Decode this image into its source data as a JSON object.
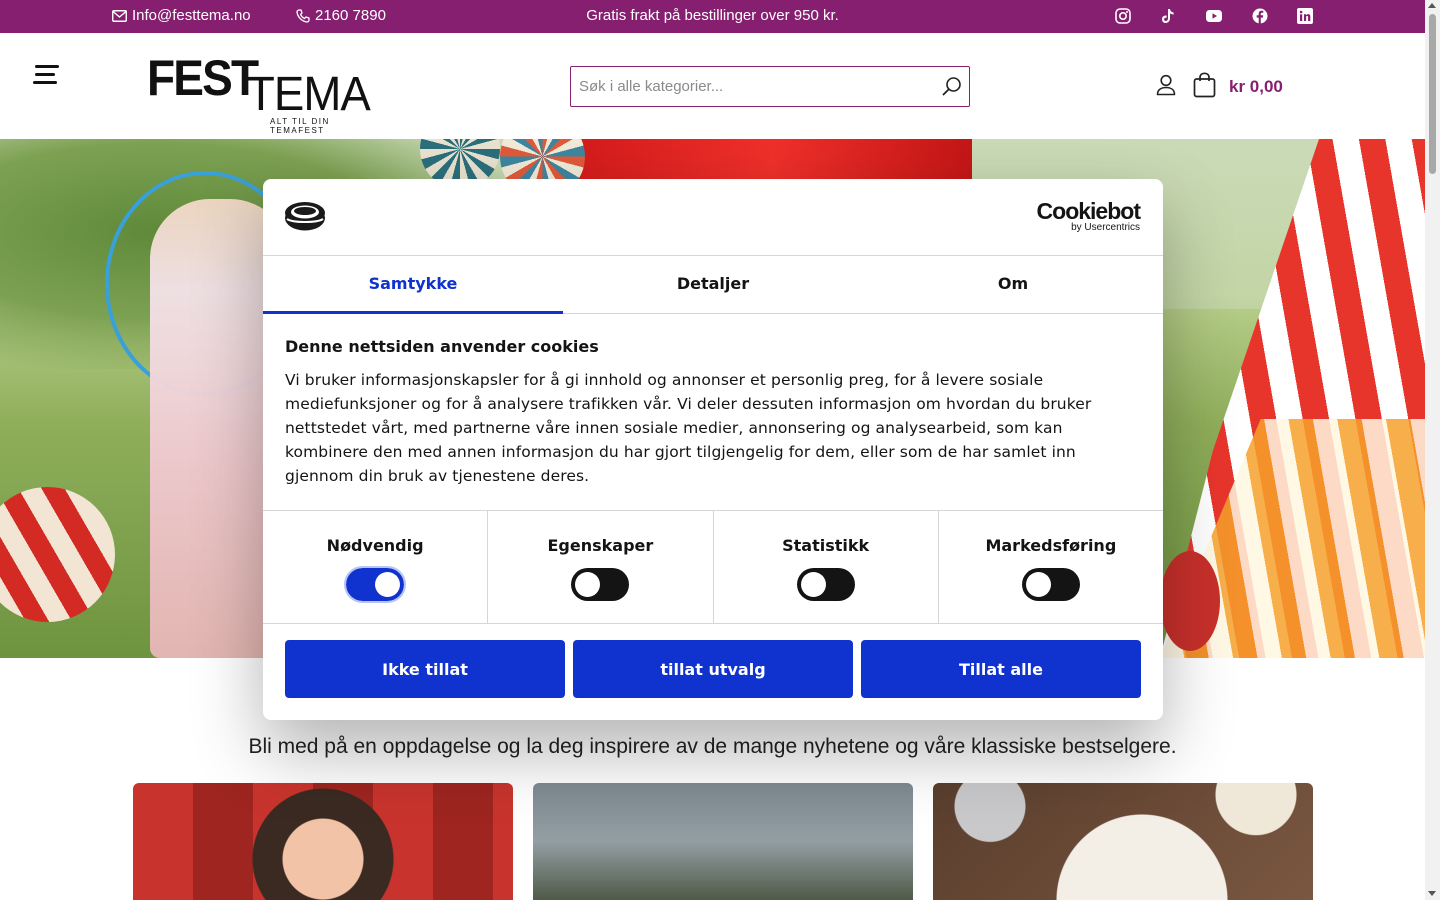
{
  "topbar": {
    "email": "Info@festtema.no",
    "phone": "2160 7890",
    "promo": "Gratis frakt på bestillinger over 950 kr.",
    "social_icons": [
      "instagram-icon",
      "tiktok-icon",
      "youtube-icon",
      "facebook-icon",
      "linkedin-icon"
    ],
    "background": "#861f70"
  },
  "header": {
    "logo_word_1": "FEST",
    "logo_word_2": "TEMA",
    "logo_tagline": "ALT TIL DIN TEMAFEST",
    "search_placeholder": "Søk i alle kategorier...",
    "cart_total": "kr 0,00",
    "accent": "#861f70"
  },
  "main": {
    "tagline": "Bli med på en oppdagelse og la deg inspirere av de mange nyhetene og våre klassiske bestselgere."
  },
  "cookie_dialog": {
    "brand": "Cookiebot",
    "brand_sub": "by Usercentrics",
    "tabs": [
      {
        "label": "Samtykke",
        "active": true
      },
      {
        "label": "Detaljer",
        "active": false
      },
      {
        "label": "Om",
        "active": false
      }
    ],
    "heading": "Denne nettsiden anvender cookies",
    "text": "Vi bruker informasjonskapsler for å gi innhold og annonser et personlig preg, for å levere sosiale mediefunksjoner og for å analysere trafikken vår. Vi deler dessuten informasjon om hvordan du bruker nettstedet vårt, med partnerne våre innen sosiale medier, annonsering og analysearbeid, som kan kombinere den med annen informasjon du har gjort tilgjengelig for dem, eller som de har samlet inn gjennom din bruk av tjenestene deres.",
    "categories": [
      {
        "label": "Nødvendig",
        "enabled": true
      },
      {
        "label": "Egenskaper",
        "enabled": false
      },
      {
        "label": "Statistikk",
        "enabled": false
      },
      {
        "label": "Markedsføring",
        "enabled": false
      }
    ],
    "buttons": {
      "deny": "Ikke tillat",
      "selection": "tillat utvalg",
      "allow_all": "Tillat alle"
    },
    "accent": "#1032cf"
  }
}
